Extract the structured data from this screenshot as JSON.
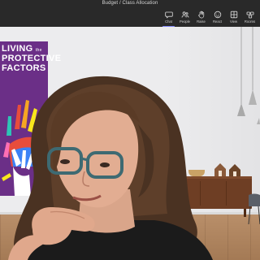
{
  "window": {
    "title": "Budget / Class Allocation"
  },
  "toolbar": {
    "items": [
      {
        "label": "Chat",
        "icon": "chat-icon",
        "active": true
      },
      {
        "label": "People",
        "icon": "people-icon",
        "active": false
      },
      {
        "label": "Raise",
        "icon": "raise-hand-icon",
        "active": false
      },
      {
        "label": "React",
        "icon": "react-icon",
        "active": false
      },
      {
        "label": "View",
        "icon": "view-icon",
        "active": false
      },
      {
        "label": "Rooms",
        "icon": "rooms-icon",
        "active": false
      }
    ]
  },
  "poster": {
    "line1": "LIVING",
    "line1_small": "the",
    "line2": "PROTECTIVE",
    "line3": "FACTORS"
  },
  "colors": {
    "toolbar_bg": "#292929",
    "accent": "#7f85f5",
    "poster_bg": "#6b2f87",
    "wall": "#ececee",
    "floor": "#b98f6a"
  }
}
